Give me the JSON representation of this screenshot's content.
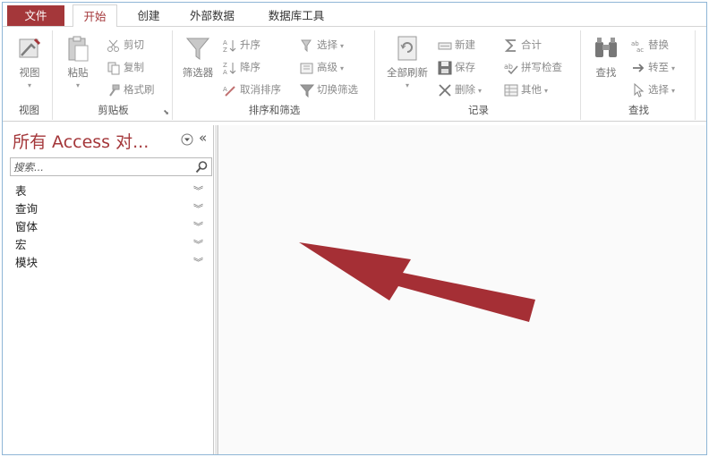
{
  "tabs": {
    "file": "文件",
    "home": "开始",
    "create": "创建",
    "external": "外部数据",
    "dbtools": "数据库工具"
  },
  "ribbon": {
    "views": {
      "view": "视图",
      "label": "视图"
    },
    "clipboard": {
      "paste": "粘贴",
      "cut": "剪切",
      "copy": "复制",
      "format_painter": "格式刷",
      "label": "剪贴板"
    },
    "sort_filter": {
      "filter": "筛选器",
      "ascending": "升序",
      "descending": "降序",
      "remove_sort": "取消排序",
      "selection": "选择",
      "advanced": "高级",
      "toggle_filter": "切换筛选",
      "label": "排序和筛选"
    },
    "records": {
      "refresh_all": "全部刷新",
      "new": "新建",
      "save": "保存",
      "delete": "删除",
      "totals": "合计",
      "spelling": "拼写检查",
      "more": "其他",
      "label": "记录"
    },
    "find": {
      "find": "查找",
      "replace": "替换",
      "goto": "转至",
      "select": "选择",
      "label": "查找"
    }
  },
  "nav_pane": {
    "title": "所有 Access 对...",
    "search_placeholder": "搜索...",
    "items": [
      "表",
      "查询",
      "窗体",
      "宏",
      "模块"
    ]
  },
  "colors": {
    "accent": "#a4373a",
    "arrow": "#a52f35"
  }
}
